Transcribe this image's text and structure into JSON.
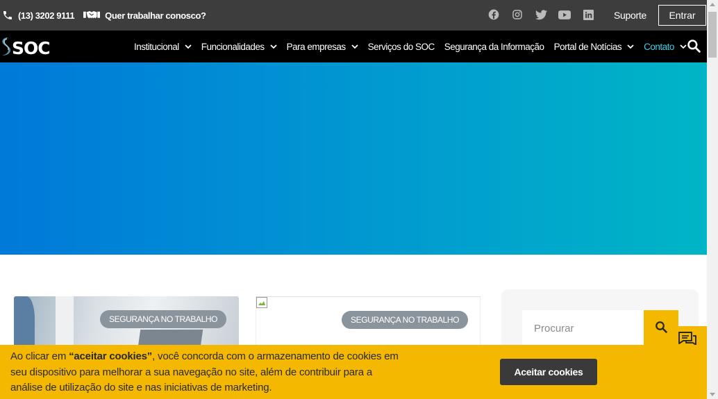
{
  "topbar": {
    "phone": "(13) 3202 9111",
    "work_with_us": "Quer trabalhar conosco?",
    "social_icons": [
      "facebook-icon",
      "instagram-icon",
      "twitter-icon",
      "youtube-icon",
      "linkedin-icon"
    ],
    "support_label": "Suporte",
    "login_label": "Entrar"
  },
  "nav": {
    "logo_text": "SOC",
    "items": [
      {
        "label": "Institucional",
        "has_dropdown": true
      },
      {
        "label": "Funcionalidades",
        "has_dropdown": true
      },
      {
        "label": "Para empresas",
        "has_dropdown": true
      },
      {
        "label": "Serviços do SOC",
        "has_dropdown": false
      },
      {
        "label": "Segurança da Informação",
        "has_dropdown": false
      },
      {
        "label": "Portal de Notícias",
        "has_dropdown": true
      },
      {
        "label": "Contato",
        "has_dropdown": true,
        "active": true
      }
    ]
  },
  "cards": [
    {
      "badge": "SEGURANÇA NO TRABALHO"
    },
    {
      "badge": "SEGURANÇA NO TRABALHO"
    }
  ],
  "sidebar": {
    "search_placeholder": "Procurar"
  },
  "cookie": {
    "text_before": "Ao clicar em ",
    "text_bold": "“aceitar cookies”",
    "text_after": ", você concorda com o armazenamento de cookies em seu dispositivo para melhorar a sua navegação no site, além de contribuir para a análise de utilização do site e nas iniciativas de marketing.",
    "accept_label": "Aceitar cookies"
  },
  "colors": {
    "topbar_bg": "#3d3d3e",
    "nav_bg": "#000000",
    "active_link": "#3fd0e6",
    "accent_yellow": "#f5b800",
    "hero_gradient_start": "#0079d9",
    "hero_gradient_end": "#00b5c6"
  }
}
